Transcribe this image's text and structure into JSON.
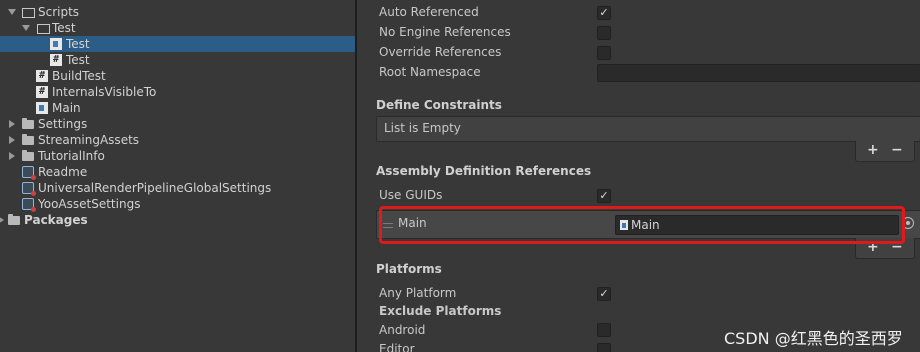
{
  "tree": {
    "items": [
      {
        "label": "Scripts",
        "icon": "folder-open-icon",
        "expanded": true
      },
      {
        "label": "Test",
        "icon": "folder-open-icon",
        "expanded": true
      },
      {
        "label": "Test",
        "icon": "assembly-definition-icon",
        "selected": true
      },
      {
        "label": "Test",
        "icon": "csharp-script-icon"
      },
      {
        "label": "BuildTest",
        "icon": "csharp-script-icon"
      },
      {
        "label": "InternalsVisibleTo",
        "icon": "csharp-script-icon"
      },
      {
        "label": "Main",
        "icon": "assembly-definition-icon"
      },
      {
        "label": "Settings",
        "icon": "folder-icon"
      },
      {
        "label": "StreamingAssets",
        "icon": "folder-icon"
      },
      {
        "label": "TutorialInfo",
        "icon": "folder-icon"
      },
      {
        "label": "Readme",
        "icon": "scriptable-object-icon"
      },
      {
        "label": "UniversalRenderPipelineGlobalSettings",
        "icon": "scriptable-object-icon"
      },
      {
        "label": "YooAssetSettings",
        "icon": "scriptable-object-icon"
      },
      {
        "label": "Packages",
        "icon": "folder-icon"
      }
    ],
    "cs_glyph": "#"
  },
  "inspector": {
    "auto_referenced": {
      "label": "Auto Referenced",
      "checked": true
    },
    "no_engine_references": {
      "label": "No Engine References",
      "checked": false
    },
    "override_references": {
      "label": "Override References",
      "checked": false
    },
    "root_namespace": {
      "label": "Root Namespace",
      "value": ""
    },
    "define_constraints": {
      "header": "Define Constraints",
      "empty_text": "List is Empty"
    },
    "assembly_refs": {
      "header": "Assembly Definition References",
      "use_guids": {
        "label": "Use GUIDs",
        "checked": true
      },
      "items": [
        {
          "label": "Main",
          "value": "Main"
        }
      ]
    },
    "platforms": {
      "header": "Platforms",
      "any_platform": {
        "label": "Any Platform",
        "checked": true
      },
      "exclude_header": "Exclude Platforms",
      "exclude": [
        {
          "label": "Android",
          "checked": false
        },
        {
          "label": "Editor",
          "checked": false
        }
      ]
    },
    "plus": "+",
    "minus": "−",
    "check_glyph": "✓"
  },
  "watermark": "CSDN @红黑色的圣西罗",
  "colors": {
    "selection": "#2c5d87",
    "highlight_box": "#e01a1a",
    "panel": "#383838"
  }
}
